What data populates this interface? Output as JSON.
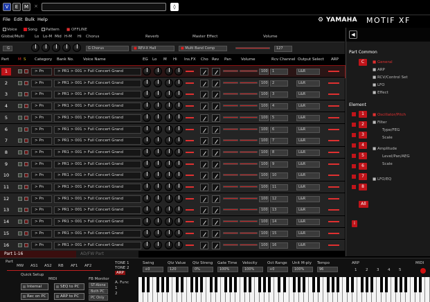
{
  "titlebar": {
    "buttons": [
      "V",
      "E",
      "M"
    ],
    "close": "×",
    "spin": "◊"
  },
  "menu": [
    "File",
    "Edit",
    "Bulk",
    "Help"
  ],
  "brand": {
    "yamaha": "YAMAHA",
    "model": "MOTIF XF"
  },
  "modes": {
    "voice": "Voice",
    "song": "Song",
    "pattern": "Pattern",
    "offline": "OFFLINE"
  },
  "global_header": [
    "Global/Multi",
    "Lo",
    "Lo-M",
    "Mid",
    "H-M",
    "Hi",
    "Chorus",
    "Reverb",
    "Master Effect",
    "Volume"
  ],
  "global_values": {
    "part": "G",
    "chorus": "G Chorus",
    "reverb": "REV-X Hall",
    "master_effect": "Multi Band Comp",
    "volume": "127"
  },
  "parts_header": [
    "Part",
    "M",
    "S",
    "Category",
    "Bank No.",
    "Voice Name",
    "EG",
    "Lo",
    "M",
    "Hi",
    "Ins.FX",
    "Cho",
    "Rev",
    "Pan",
    "Volume",
    "Rcv Channel",
    "Output Select",
    "ARP"
  ],
  "parts": [
    {
      "num": "1",
      "cat": "> Pn",
      "bank": "> PR1 > 001 > Full Concert Grand",
      "vol": "100",
      "ch": "1",
      "out": "L&R"
    },
    {
      "num": "2",
      "cat": "> Pn",
      "bank": "> PR1 > 001 > Full Concert Grand",
      "vol": "100",
      "ch": "2",
      "out": "L&R"
    },
    {
      "num": "3",
      "cat": "> Pn",
      "bank": "> PR1 > 001 > Full Concert Grand",
      "vol": "100",
      "ch": "3",
      "out": "L&R"
    },
    {
      "num": "4",
      "cat": "> Pn",
      "bank": "> PR1 > 001 > Full Concert Grand",
      "vol": "100",
      "ch": "4",
      "out": "L&R"
    },
    {
      "num": "5",
      "cat": "> Pn",
      "bank": "> PR1 > 001 > Full Concert Grand",
      "vol": "100",
      "ch": "5",
      "out": "L&R"
    },
    {
      "num": "6",
      "cat": "> Pn",
      "bank": "> PR1 > 001 > Full Concert Grand",
      "vol": "100",
      "ch": "6",
      "out": "L&R"
    },
    {
      "num": "7",
      "cat": "> Pn",
      "bank": "> PR1 > 001 > Full Concert Grand",
      "vol": "100",
      "ch": "7",
      "out": "L&R"
    },
    {
      "num": "8",
      "cat": "> Pn",
      "bank": "> PR1 > 001 > Full Concert Grand",
      "vol": "100",
      "ch": "8",
      "out": "L&R"
    },
    {
      "num": "9",
      "cat": "> Pn",
      "bank": "> PR1 > 001 > Full Concert Grand",
      "vol": "100",
      "ch": "9",
      "out": "L&R"
    },
    {
      "num": "10",
      "cat": "> Pn",
      "bank": "> PR1 > 001 > Full Concert Grand",
      "vol": "100",
      "ch": "10",
      "out": "L&R"
    },
    {
      "num": "11",
      "cat": "> Pn",
      "bank": "> PR1 > 001 > Full Concert Grand",
      "vol": "100",
      "ch": "11",
      "out": "L&R"
    },
    {
      "num": "12",
      "cat": "> Pn",
      "bank": "> PR1 > 001 > Full Concert Grand",
      "vol": "100",
      "ch": "12",
      "out": "L&R"
    },
    {
      "num": "13",
      "cat": "> Pn",
      "bank": "> PR1 > 001 > Full Concert Grand",
      "vol": "100",
      "ch": "13",
      "out": "L&R"
    },
    {
      "num": "14",
      "cat": "> Pn",
      "bank": "> PR1 > 001 > Full Concert Grand",
      "vol": "100",
      "ch": "14",
      "out": "L&R"
    },
    {
      "num": "15",
      "cat": "> Pn",
      "bank": "> PR1 > 001 > Full Concert Grand",
      "vol": "100",
      "ch": "15",
      "out": "L&R"
    },
    {
      "num": "16",
      "cat": "> Pn",
      "bank": "> PR1 > 001 > Full Concert Grand",
      "vol": "100",
      "ch": "16",
      "out": "L&R"
    }
  ],
  "tabs": {
    "active": "Part 1-16",
    "other": "AD/FW Part"
  },
  "bottom": {
    "part_label": "Part",
    "knob_labels": [
      "MW",
      "AS1",
      "AS2",
      "RB",
      "AF1",
      "AF2"
    ],
    "quick_setup": "Quick Setup",
    "midi": "MIDI",
    "fb_monitor": "FB Monitor",
    "buttons": [
      "Internal",
      "SEQ to PC",
      "Rec on PC",
      "ARP to PC"
    ],
    "monitor_options": [
      "ST-Alone",
      "Both PC",
      "PC Only"
    ],
    "tones": [
      "TONE 1",
      "TONE 2",
      "ARP"
    ],
    "a_func": "A. Func",
    "a_func_nums": [
      "1",
      "2"
    ],
    "params": [
      {
        "label": "Swing",
        "value": "+0"
      },
      {
        "label": "Qtz Value",
        "value": "120"
      },
      {
        "label": "Qtz Streng",
        "value": "0%"
      },
      {
        "label": "Gate Time",
        "value": "100%"
      },
      {
        "label": "Velocity",
        "value": "100%"
      },
      {
        "label": "Oct Range",
        "value": "+0"
      },
      {
        "label": "Unit M-ply",
        "value": "100%"
      },
      {
        "label": "Tempo",
        "value": "96"
      }
    ],
    "arp_label": "ARP",
    "arp_nums": [
      "1",
      "2",
      "3",
      "4",
      "5"
    ],
    "midi_right": "MIDI"
  },
  "panel": {
    "part_common": "Part Common",
    "common_btn": "C",
    "general": "General",
    "common_items": [
      "ARP",
      "RCV/Control Set",
      "LFO",
      "Effect"
    ],
    "element": "Element",
    "elements": [
      "1",
      "2",
      "3",
      "4",
      "5",
      "6",
      "7",
      "8"
    ],
    "all": "All",
    "element_items": [
      "Oscillator/Pitch",
      "Filter",
      "Type/FEG",
      "Scale",
      "Amplitude",
      "Level/Pan/AEG",
      "Scale",
      "LFO/EQ"
    ],
    "info": "i"
  }
}
